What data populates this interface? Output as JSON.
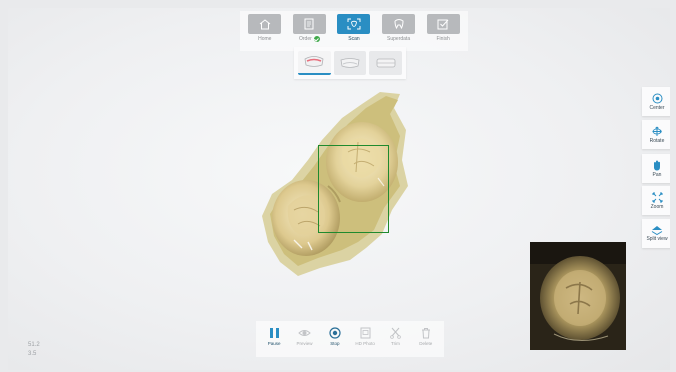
{
  "workflow": {
    "steps": [
      {
        "label": "Home",
        "icon": "home-icon",
        "active": false
      },
      {
        "label": "Order",
        "icon": "order-icon",
        "active": false,
        "done": true
      },
      {
        "label": "Scan",
        "icon": "scan-icon",
        "active": true
      },
      {
        "label": "Superdata",
        "icon": "tooth-icon",
        "active": false
      },
      {
        "label": "Finish",
        "icon": "finish-icon",
        "active": false
      }
    ]
  },
  "scan_types": [
    {
      "icon": "upper-jaw-icon",
      "selected": true
    },
    {
      "icon": "lower-jaw-icon",
      "selected": false
    },
    {
      "icon": "bite-icon",
      "selected": false
    }
  ],
  "view_tools": [
    {
      "label": "Center",
      "icon": "target-icon"
    },
    {
      "label": "Rotate",
      "icon": "rotate-icon"
    },
    {
      "label": "Pan",
      "icon": "hand-icon"
    },
    {
      "label": "Zoom",
      "icon": "zoom-icon"
    },
    {
      "label": "Split view",
      "icon": "split-view-icon"
    }
  ],
  "scan_tools": [
    {
      "label": "Pause",
      "icon": "pause-icon",
      "enabled": true
    },
    {
      "label": "Preview",
      "icon": "eye-icon",
      "enabled": false
    },
    {
      "label": "Stop",
      "icon": "stop-icon",
      "enabled": true
    },
    {
      "label": "HD Photo",
      "icon": "photo-icon",
      "enabled": false
    },
    {
      "label": "Trim",
      "icon": "scissors-icon",
      "enabled": false
    },
    {
      "label": "Delete",
      "icon": "trash-icon",
      "enabled": false
    }
  ],
  "readout": {
    "line1": "51.2",
    "line2": "3.5"
  },
  "colors": {
    "accent": "#2a8ec3",
    "focus_box": "#1f8a2e",
    "check": "#3fa84a"
  }
}
